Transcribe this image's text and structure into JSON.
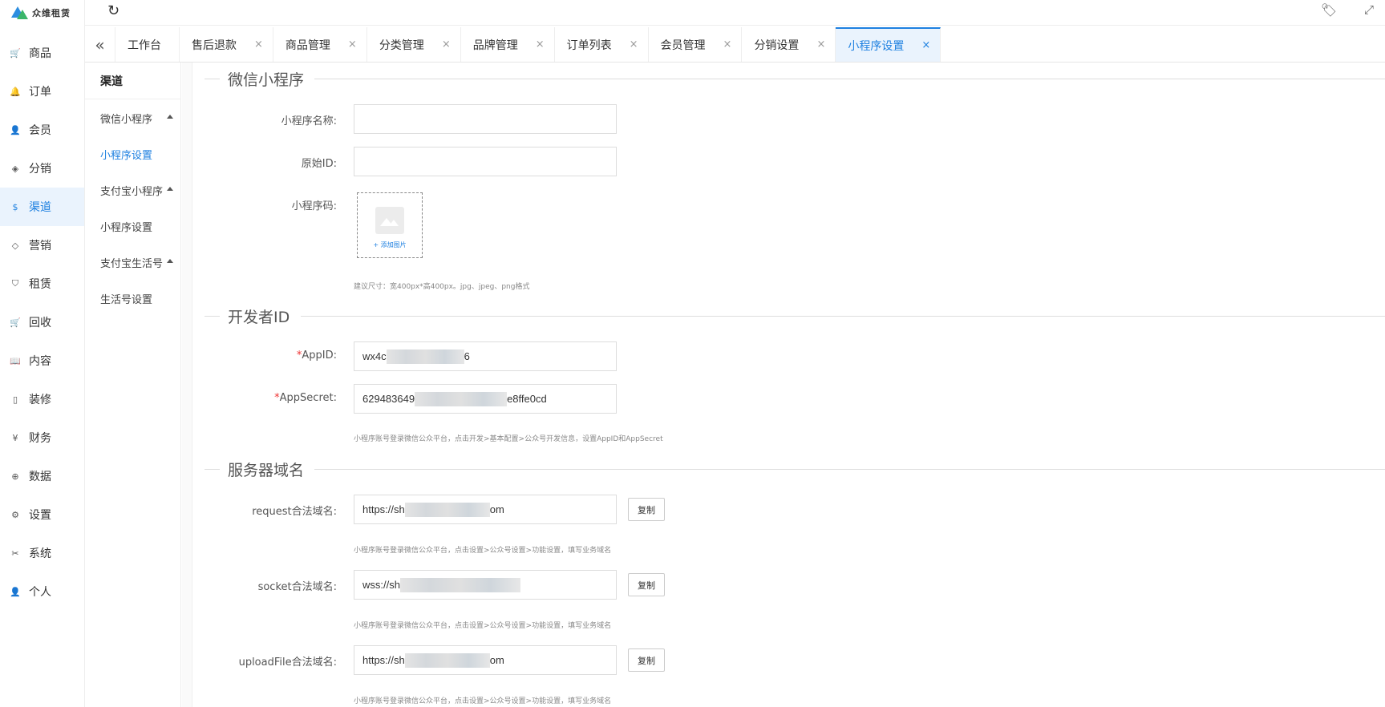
{
  "brand": {
    "name": "众维租赁"
  },
  "nav": {
    "items": [
      {
        "label": "商品",
        "icon": "cart-icon",
        "glyph": "🛒"
      },
      {
        "label": "订单",
        "icon": "bell-icon",
        "glyph": "🔔"
      },
      {
        "label": "会员",
        "icon": "user-icon",
        "glyph": "👤"
      },
      {
        "label": "分销",
        "icon": "layers-icon",
        "glyph": "◈"
      },
      {
        "label": "渠道",
        "icon": "dollar-circle-icon",
        "glyph": "$",
        "active": true
      },
      {
        "label": "营销",
        "icon": "diamond-icon",
        "glyph": "◇"
      },
      {
        "label": "租赁",
        "icon": "shield-icon",
        "glyph": "⛉"
      },
      {
        "label": "回收",
        "icon": "cart-icon",
        "glyph": "🛒"
      },
      {
        "label": "内容",
        "icon": "book-icon",
        "glyph": "📖"
      },
      {
        "label": "装修",
        "icon": "tablet-icon",
        "glyph": "▯"
      },
      {
        "label": "财务",
        "icon": "yen-icon",
        "glyph": "¥"
      },
      {
        "label": "数据",
        "icon": "globe-icon",
        "glyph": "⊕"
      },
      {
        "label": "设置",
        "icon": "gear-icon",
        "glyph": "⚙"
      },
      {
        "label": "系统",
        "icon": "tools-icon",
        "glyph": "✂"
      },
      {
        "label": "个人",
        "icon": "person-icon",
        "glyph": "👤"
      }
    ]
  },
  "tabs": [
    {
      "label": "工作台",
      "closable": false
    },
    {
      "label": "售后退款",
      "closable": true
    },
    {
      "label": "商品管理",
      "closable": true
    },
    {
      "label": "分类管理",
      "closable": true
    },
    {
      "label": "品牌管理",
      "closable": true
    },
    {
      "label": "订单列表",
      "closable": true
    },
    {
      "label": "会员管理",
      "closable": true
    },
    {
      "label": "分销设置",
      "closable": true
    },
    {
      "label": "小程序设置",
      "closable": true,
      "active": true
    }
  ],
  "submenu": {
    "title": "渠道",
    "groups": [
      {
        "label": "微信小程序",
        "items": [
          {
            "label": "小程序设置",
            "active": true
          }
        ]
      },
      {
        "label": "支付宝小程序",
        "items": [
          {
            "label": "小程序设置"
          }
        ]
      },
      {
        "label": "支付宝生活号",
        "items": [
          {
            "label": "生活号设置"
          }
        ]
      }
    ]
  },
  "form": {
    "wechat": {
      "title": "微信小程序",
      "name_label": "小程序名称:",
      "name_value": "",
      "origin_label": "原始ID:",
      "origin_value": "",
      "code_label": "小程序码:",
      "upload_text": "+ 添加图片",
      "size_hint": "建议尺寸：宽400px*高400px。jpg、jpeg、png格式"
    },
    "developer": {
      "title": "开发者ID",
      "appid_label": "AppID:",
      "appid_prefix": "wx4c",
      "appid_suffix": "6",
      "secret_label": "AppSecret:",
      "secret_prefix": "629483649",
      "secret_suffix": "e8ffe0cd",
      "hint": "小程序账号登录微信公众平台，点击开发>基本配置>公众号开发信息，设置AppID和AppSecret"
    },
    "server": {
      "title": "服务器域名",
      "copy_label": "复制",
      "domain_hint": "小程序账号登录微信公众平台，点击设置>公众号设置>功能设置，填写业务域名",
      "request_label": "request合法域名:",
      "request_prefix": "https://sh",
      "request_suffix": "om",
      "socket_label": "socket合法域名:",
      "socket_prefix": "wss://sh",
      "socket_suffix": "",
      "upload_label": "uploadFile合法域名:",
      "upload_prefix": "https://sh",
      "upload_suffix": "om"
    }
  }
}
